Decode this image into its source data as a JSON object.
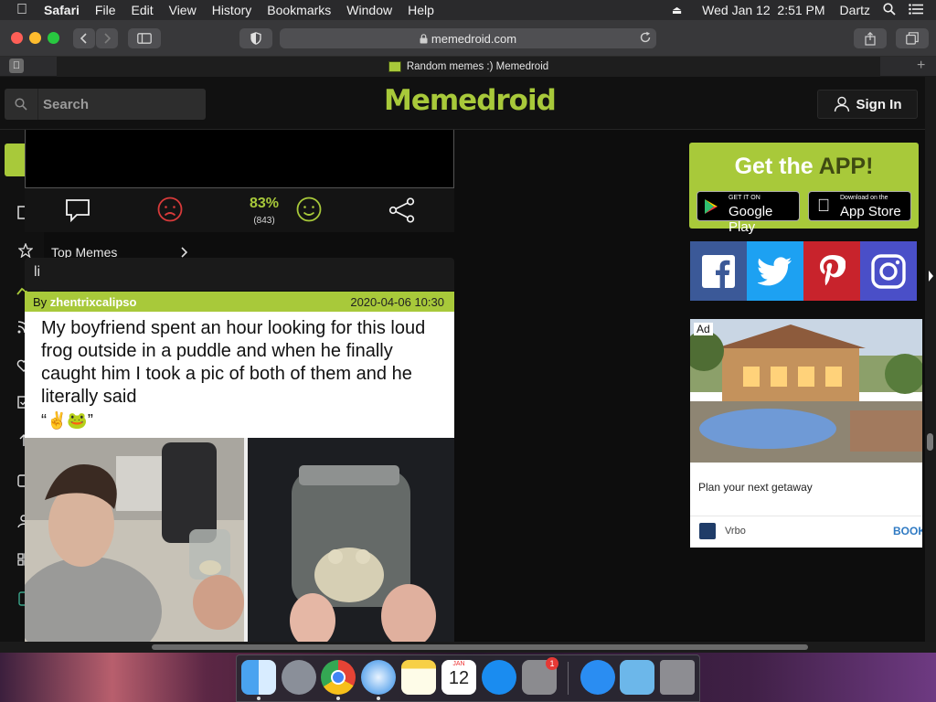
{
  "menubar": {
    "app": "Safari",
    "items": [
      "File",
      "Edit",
      "View",
      "History",
      "Bookmarks",
      "Window",
      "Help"
    ],
    "clock": "Wed Jan 12  2:51 PM",
    "user": "Dartz"
  },
  "toolbar": {
    "url": "memedroid.com"
  },
  "tab": {
    "title": "Random memes :) Memedroid"
  },
  "site": {
    "search_placeholder": "Search",
    "logo": "Memedroid",
    "signin_label": "Sign In"
  },
  "sidebar": {
    "top_memes_label": "Top Memes"
  },
  "vote": {
    "percent": "83%",
    "count": "(843)"
  },
  "tooltip": {
    "text": "li"
  },
  "post": {
    "by_label": "By",
    "author": "zhentrixcalipso",
    "date": "2020-04-06 10:30",
    "caption": "My boyfriend spent an hour looking for this loud frog outside in a puddle and when he finally caught him I took a pic of both of them and he literally said",
    "quote": "“✌️🐸”"
  },
  "promo": {
    "title_prefix": "Get the ",
    "title_suffix": "APP!",
    "google_small": "GET IT ON",
    "google_big": "Google Play",
    "apple_small": "Download on the",
    "apple_big": "App Store"
  },
  "social": [
    "facebook",
    "twitter",
    "pinterest",
    "instagram"
  ],
  "ad": {
    "label": "Ad",
    "text": "Plan your next getaway",
    "advertiser": "Vrbo",
    "cta": "BOOK"
  },
  "dock": {
    "calendar_month": "JAN",
    "calendar_day": "12",
    "settings_badge": "1"
  },
  "colors": {
    "brand_green": "#a8c93a",
    "facebook": "#3b5998",
    "twitter": "#1da1f2",
    "pinterest": "#c8232c",
    "instagram": "#4a4fc8"
  }
}
